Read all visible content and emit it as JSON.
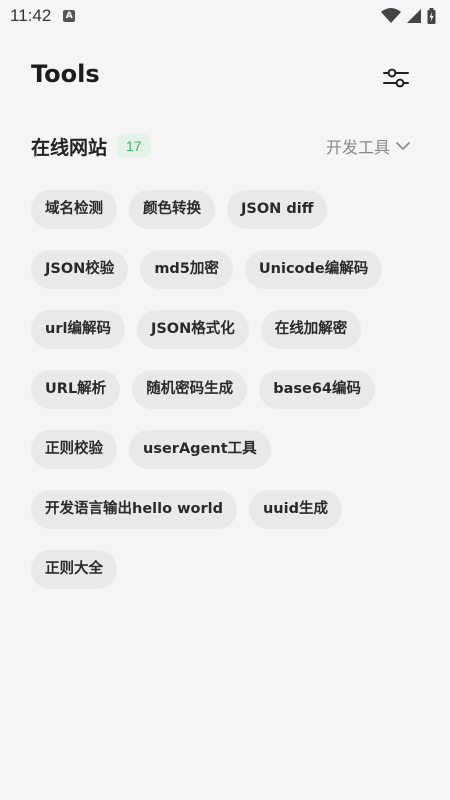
{
  "status_bar": {
    "time": "11:42",
    "app_icon_letter": "A"
  },
  "header": {
    "title": "Tools"
  },
  "section": {
    "title": "在线网站",
    "count": "17",
    "category": "开发工具"
  },
  "tools": [
    "域名检测",
    "颜色转换",
    "JSON diff",
    "JSON校验",
    "md5加密",
    "Unicode编解码",
    "url编解码",
    "JSON格式化",
    "在线加解密",
    "URL解析",
    "随机密码生成",
    "base64编码",
    "正则校验",
    "userAgent工具",
    "开发语言输出hello world",
    "uuid生成",
    "正则大全"
  ]
}
